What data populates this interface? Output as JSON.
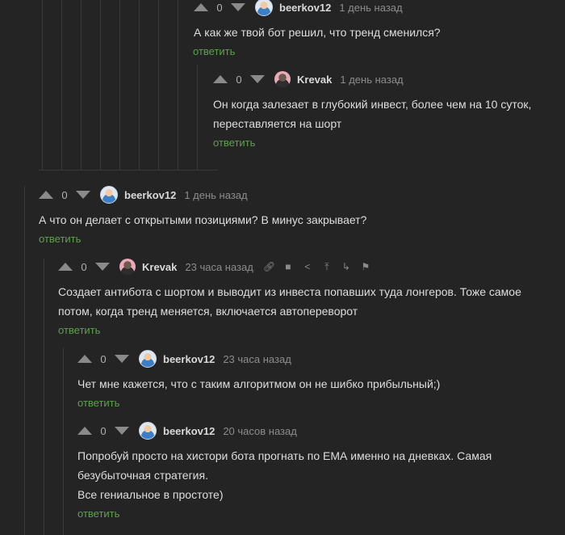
{
  "comments": [
    {
      "rating": "0",
      "author": "beerkov12",
      "time": "1 день назад",
      "lines": [
        "А как же твой бот решил, что тренд сменился?"
      ],
      "reply": "ответить"
    },
    {
      "rating": "0",
      "author": "Krevak",
      "time": "1 день назад",
      "lines": [
        "Он когда залезает в глубокий инвест, более чем на 10 суток,",
        "переставляется на шорт"
      ],
      "reply": "ответить"
    },
    {
      "rating": "0",
      "author": "beerkov12",
      "time": "1 день назад",
      "lines": [
        "А что он делает с открытыми позициями? В минус закрывает?"
      ],
      "reply": "ответить"
    },
    {
      "rating": "0",
      "author": "Krevak",
      "time": "23 часа назад",
      "lines": [
        "Создает антибота с шортом и выводит из инвеста попавших туда лонгеров. Тоже самое",
        "потом, когда тренд меняется, включается автопереворот"
      ],
      "reply": "ответить"
    },
    {
      "rating": "0",
      "author": "beerkov12",
      "time": "23 часа назад",
      "lines": [
        "Чет мне кажется, что с таким алгоритмом он не шибко прибыльный;)"
      ],
      "reply": "ответить"
    },
    {
      "rating": "0",
      "author": "beerkov12",
      "time": "20 часов назад",
      "lines": [
        "Попробуй просто на хистори бота прогнать по ЕМА именно на дневках. Самая",
        "безубыточная стратегия.",
        "Все гениальное в простоте)"
      ],
      "reply": "ответить"
    }
  ],
  "tool_icons": [
    "link-icon",
    "save-icon",
    "share-icon",
    "scroll-top-icon",
    "branch-icon",
    "flag-icon"
  ],
  "colors": {
    "background": "#242424",
    "reply": "#5fa04e",
    "thread_line": "#3a3a3a"
  }
}
